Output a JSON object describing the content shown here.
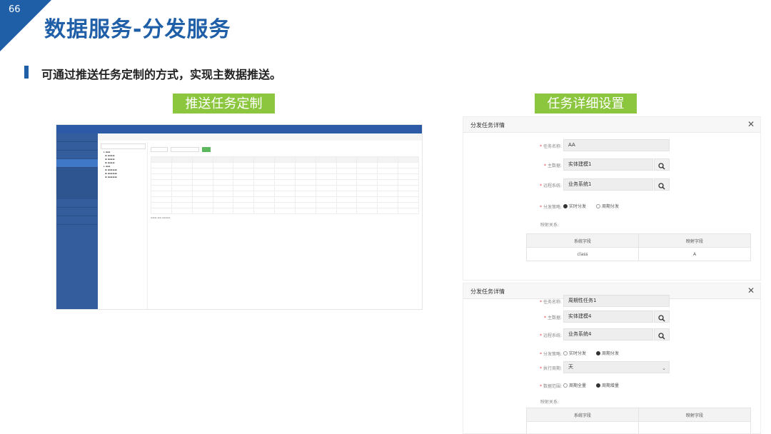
{
  "slide": {
    "page_number": "66",
    "title": "数据服务-分发服务",
    "subtitle": "可通过推送任务定制的方式，实现主数据推送。",
    "label_left": "推送任务定制",
    "label_right": "任务详细设置",
    "accent_color": "#1f5fa8",
    "label_color": "#8cc63f"
  },
  "dialog1": {
    "title": "分发任务详情",
    "fields": {
      "task_name_label": "任务名称:",
      "task_name_value": "AA",
      "main_data_label": "主数据:",
      "main_data_value": "实体建模1",
      "remote_system_label": "远程系统:",
      "remote_system_value": "业务系统1",
      "strategy_label": "分发策略:",
      "strategy_opt1": "实时分发",
      "strategy_opt2": "周期分发",
      "mapping_label": "映射关系:"
    },
    "mapping": {
      "col1": "系统字段",
      "col2": "映射字段",
      "row_field": "class",
      "row_map": "A"
    }
  },
  "dialog2": {
    "title": "分发任务详情",
    "fields": {
      "task_name_label": "任务名称:",
      "task_name_value": "周期性任务1",
      "main_data_label": "主数据:",
      "main_data_value": "实体建模4",
      "remote_system_label": "远程系统:",
      "remote_system_value": "业务系统4",
      "strategy_label": "分发策略:",
      "strategy_opt1": "实时分发",
      "strategy_opt2": "周期分发",
      "cycle_label": "执行周期:",
      "cycle_value": "天",
      "range_label": "数据范围:",
      "range_opt1": "周期全量",
      "range_opt2": "周期增量",
      "mapping_label": "映射关系:"
    },
    "mapping": {
      "col1": "系统字段",
      "col2": "映射字段"
    }
  }
}
